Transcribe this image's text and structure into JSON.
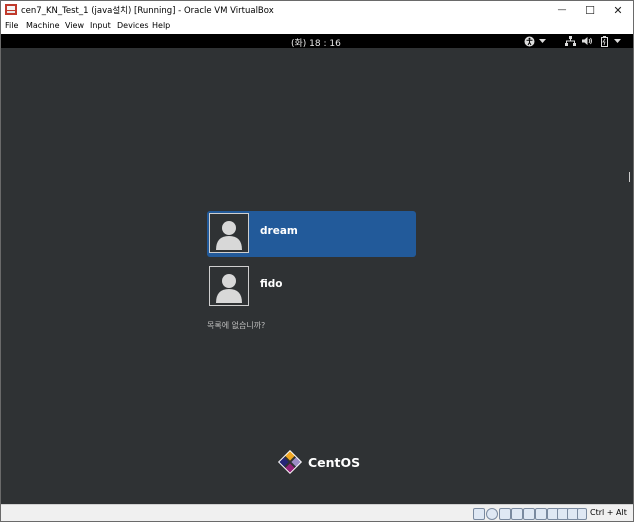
{
  "window": {
    "title": "cen7_KN_Test_1 (java설치) [Running] - Oracle VM VirtualBox",
    "minimize_glyph": "—",
    "maximize_glyph": "☐",
    "close_glyph": "✕"
  },
  "menubar": {
    "items": [
      "File",
      "Machine",
      "View",
      "Input",
      "Devices",
      "Help"
    ]
  },
  "gnome_topbar": {
    "clock": "(화) 18 : 16",
    "icons": [
      "accessibility-icon",
      "chevron-down-icon",
      "network-icon",
      "volume-icon",
      "battery-icon",
      "chevron-down-icon"
    ]
  },
  "login": {
    "users": [
      {
        "name": "dream",
        "selected": true
      },
      {
        "name": "fido",
        "selected": false
      }
    ],
    "not_listed": "목록에 없습니까?"
  },
  "branding": {
    "logo_text": "CentOS",
    "logo_colors": [
      "#efa724",
      "#262577",
      "#9c8dc4",
      "#932279"
    ]
  },
  "statusbar": {
    "host_key": "Ctrl + Alt",
    "icons": [
      "hard-disk-icon",
      "optical-drive-icon",
      "audio-icon",
      "network-adapter-icon",
      "usb-icon",
      "shared-folder-icon",
      "display-icon",
      "video-capture-icon",
      "recording-icon",
      "cpu-icon",
      "mouse-integration-icon",
      "keyboard-icon"
    ]
  },
  "colors": {
    "desktop_bg": "#2f3234",
    "selection": "#225a9a"
  }
}
